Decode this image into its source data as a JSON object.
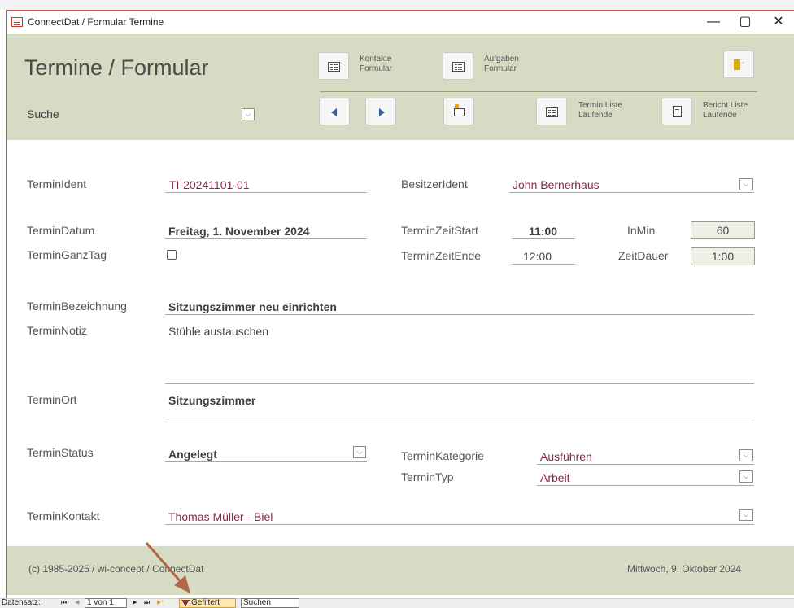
{
  "window": {
    "title": "ConnectDat / Formular Termine",
    "minimize": "—",
    "maximize": "▢",
    "close": "✕"
  },
  "header": {
    "title": "Termine / Formular",
    "search_label": "Suche",
    "btn_kontakte_line1": "Kontakte",
    "btn_kontakte_line2": "Formular",
    "btn_aufgaben_line1": "Aufgaben",
    "btn_aufgaben_line2": "Formular",
    "btn_termin_liste_line1": "Termin Liste",
    "btn_termin_liste_line2": "Laufende",
    "btn_bericht_liste_line1": "Bericht Liste",
    "btn_bericht_liste_line2": "Laufende"
  },
  "fields": {
    "termin_ident_label": "TerminIdent",
    "termin_ident_value": "TI-20241101-01",
    "besitzer_ident_label": "BesitzerIdent",
    "besitzer_ident_value": "John Bernerhaus",
    "termin_datum_label": "TerminDatum",
    "termin_datum_value": "Freitag, 1. November 2024",
    "termin_zeit_start_label": "TerminZeitStart",
    "termin_zeit_start_value": "11:00",
    "in_min_label": "InMin",
    "in_min_value": "60",
    "termin_ganztag_label": "TerminGanzTag",
    "termin_ganztag_checked": false,
    "termin_zeit_ende_label": "TerminZeitEnde",
    "termin_zeit_ende_value": "12:00",
    "zeit_dauer_label": "ZeitDauer",
    "zeit_dauer_value": "1:00",
    "termin_bezeichnung_label": "TerminBezeichnung",
    "termin_bezeichnung_value": "Sitzungszimmer neu einrichten",
    "termin_notiz_label": "TerminNotiz",
    "termin_notiz_value": "Stühle austauschen",
    "termin_ort_label": "TerminOrt",
    "termin_ort_value": "Sitzungszimmer",
    "termin_status_label": "TerminStatus",
    "termin_status_value": "Angelegt",
    "termin_kategorie_label": "TerminKategorie",
    "termin_kategorie_value": "Ausführen",
    "termin_typ_label": "TerminTyp",
    "termin_typ_value": "Arbeit",
    "termin_kontakt_label": "TerminKontakt",
    "termin_kontakt_value": "Thomas Müller - Biel"
  },
  "footer": {
    "copyright": "(c) 1985-2025 / wi-concept / ConnectDat",
    "date": "Mittwoch, 9. Oktober 2024"
  },
  "record_nav": {
    "label": "Datensatz:",
    "first": "⏮",
    "prev": "◀",
    "position": "1 von 1",
    "next": "▶",
    "last": "⏭",
    "new": "▶*",
    "filter": "Gefiltert",
    "search": "Suchen"
  },
  "colors": {
    "accent_bg": "#d6dcc3",
    "value_maroon": "#8b2742",
    "arrow_annotation": "#b5664a"
  }
}
